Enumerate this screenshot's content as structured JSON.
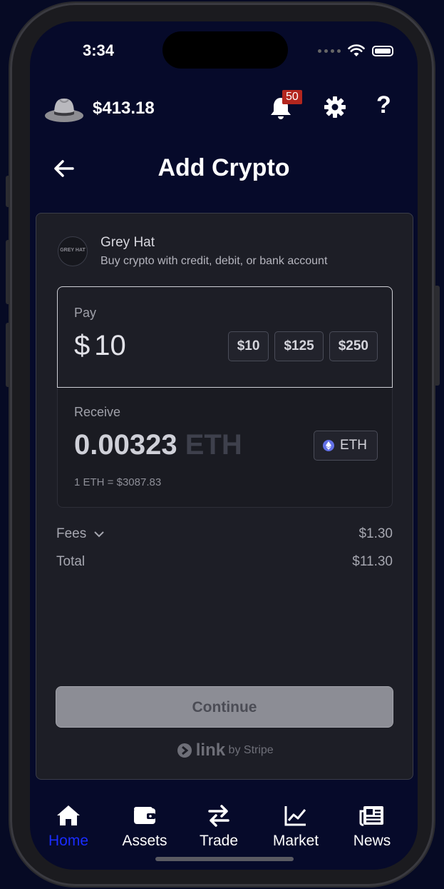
{
  "status": {
    "time": "3:34"
  },
  "header": {
    "balance": "$413.18",
    "notification_count": "50",
    "help_label": "?"
  },
  "page": {
    "title": "Add Crypto"
  },
  "merchant": {
    "name": "Grey Hat",
    "subtitle": "Buy crypto with credit, debit, or bank account",
    "logo_text": "GREY HAT"
  },
  "pay": {
    "label": "Pay",
    "currency_symbol": "$",
    "amount": "10",
    "presets": [
      "$10",
      "$125",
      "$250"
    ]
  },
  "receive": {
    "label": "Receive",
    "amount": "0.00323",
    "unit": "ETH",
    "asset_button": "ETH",
    "rate": "1 ETH = $3087.83"
  },
  "fees": {
    "label": "Fees",
    "value": "$1.30"
  },
  "total": {
    "label": "Total",
    "value": "$11.30"
  },
  "actions": {
    "continue_label": "Continue"
  },
  "footer": {
    "link_label": "link",
    "by_label": "by Stripe"
  },
  "tabs": [
    {
      "label": "Home",
      "icon": "home-icon",
      "active": true
    },
    {
      "label": "Assets",
      "icon": "wallet-icon"
    },
    {
      "label": "Trade",
      "icon": "swap-icon"
    },
    {
      "label": "Market",
      "icon": "chart-icon"
    },
    {
      "label": "News",
      "icon": "newspaper-icon"
    }
  ],
  "colors": {
    "accent": "#1a2cff",
    "badge": "#b3261e",
    "eth": "#6270e6"
  }
}
